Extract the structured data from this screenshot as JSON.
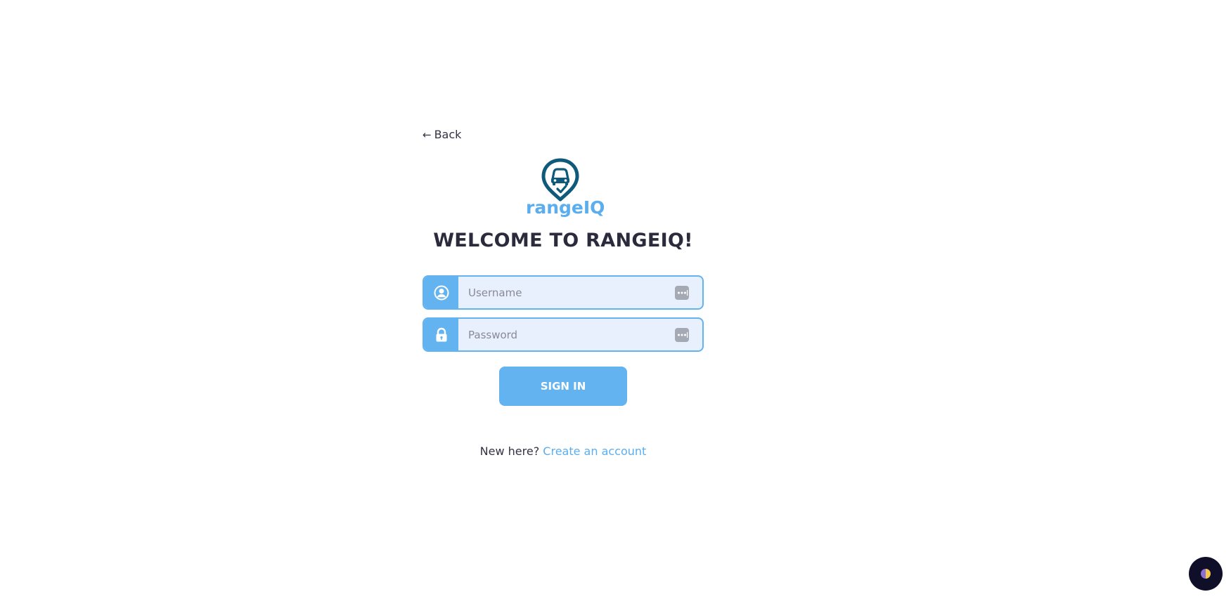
{
  "nav": {
    "back_arrow": "←",
    "back_label": "Back"
  },
  "logo": {
    "text": "rangeIQ",
    "brand_color": "#5aaeef",
    "mark_color": "#0f5a7a"
  },
  "heading": "WELCOME TO RANGEIQ!",
  "form": {
    "username": {
      "placeholder": "Username",
      "value": "",
      "icon": "user-circle-icon"
    },
    "password": {
      "placeholder": "Password",
      "value": "",
      "icon": "lock-icon"
    },
    "autofill_icon": "password-manager-icon",
    "submit_label": "SIGN IN"
  },
  "signup": {
    "prompt": "New here?",
    "link_label": "Create an account"
  },
  "theme_toggle": {
    "icon": "half-moon-icon"
  },
  "colors": {
    "accent": "#64b3f1",
    "input_bg": "#e8f0fe",
    "text_dark": "#2b2b3d",
    "toggle_bg": "#0f0f2a"
  }
}
